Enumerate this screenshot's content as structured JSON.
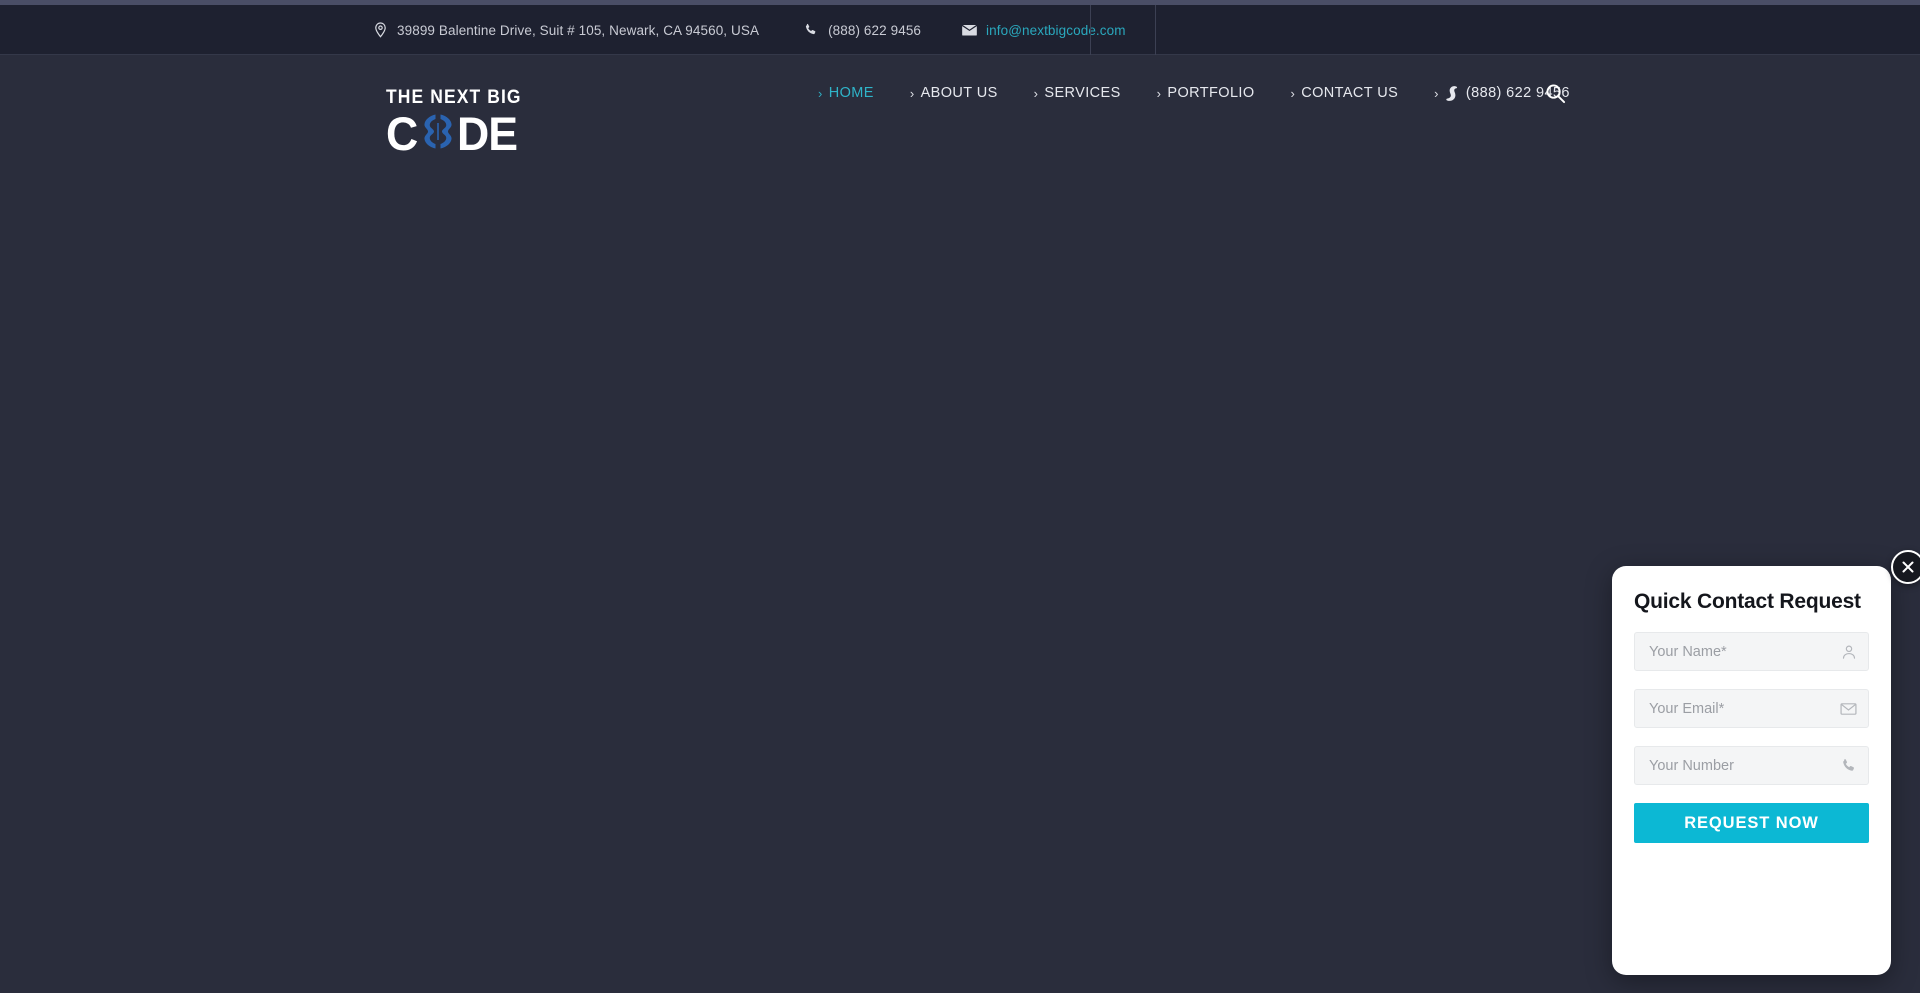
{
  "site": {
    "title": "The Next Big Code",
    "accent_cyan": "#2fb4c9",
    "button_cyan": "#0cb8d4",
    "topbar_bg": "#1e2130",
    "page_bg": "#2a2d3c",
    "logo_blue": "#2a63b0"
  },
  "topbar": {
    "address": "39899 Balentine Drive, Suit # 105, Newark, CA 94560, USA",
    "phone": "(888) 622 9456",
    "email": "info@nextbigcode.com",
    "icons": {
      "address": "map-pin-icon",
      "phone": "phone-icon",
      "email": "envelope-icon"
    }
  },
  "logo": {
    "line1": "THE NEXT BIG",
    "left": "C",
    "right": "DE",
    "o_glyph": "code-brackets-o"
  },
  "nav": {
    "items": [
      {
        "label": "HOME",
        "active": true
      },
      {
        "label": "ABOUT US",
        "active": false
      },
      {
        "label": "SERVICES",
        "active": false
      },
      {
        "label": "PORTFOLIO",
        "active": false
      },
      {
        "label": "CONTACT US",
        "active": false
      }
    ],
    "phone_item": "(888) 622 9456",
    "search_icon": "search-icon"
  },
  "popup": {
    "title": "Quick Contact Request",
    "close_label": "×",
    "fields": [
      {
        "placeholder": "Your Name*",
        "value": "",
        "icon": "person-icon"
      },
      {
        "placeholder": "Your Email*",
        "value": "",
        "icon": "envelope-icon"
      },
      {
        "placeholder": "Your Number",
        "value": "",
        "icon": "phone-icon"
      }
    ],
    "submit_label": "REQUEST NOW"
  }
}
